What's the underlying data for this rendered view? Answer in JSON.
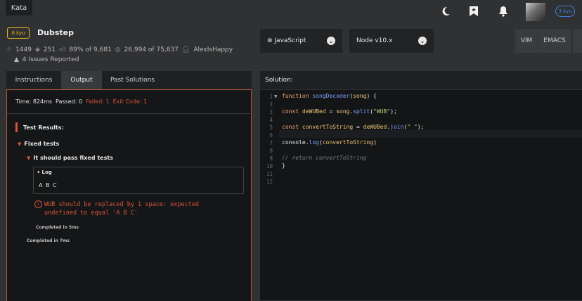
{
  "topbar": {
    "kata_label": "Kata",
    "rank": "3 kyu"
  },
  "kata": {
    "rank": "6 kyu",
    "title": "Dubstep",
    "stars": "1449",
    "collections": "251",
    "satisfaction": "89% of 9,681",
    "completed": "26,994 of 75,637",
    "author": "AlexIsHappy",
    "issues": "4 Issues Reported"
  },
  "editor_settings": {
    "language": "JavaScript",
    "runtime": "Node v10.x",
    "keybindings": [
      "VIM",
      "EMACS"
    ]
  },
  "tabs": [
    {
      "label": "Instructions"
    },
    {
      "label": "Output"
    },
    {
      "label": "Past Solutions"
    }
  ],
  "output": {
    "time": "Time: 824ms",
    "passed": "Passed: 0",
    "failed": "Failed: 1",
    "exit_code": "Exit Code: 1",
    "results_title": "Test Results:",
    "group": "Fixed tests",
    "test": "It should pass fixed tests",
    "log_label": "Log",
    "log_value": "A B C",
    "error": "WUB should be replaced by 1 space: expected undefined to equal 'A B C'",
    "completed_inner": "Completed in 5ms",
    "completed_outer": "Completed in 7ms"
  },
  "solution": {
    "label": "Solution:",
    "line_numbers": [
      "1",
      "2",
      "3",
      "4",
      "5",
      "6",
      "7",
      "8",
      "9",
      "10",
      "11",
      "12"
    ]
  },
  "icons": {
    "moon": "moon-icon",
    "bookmark": "bookmark-icon",
    "bell": "bell-icon"
  }
}
